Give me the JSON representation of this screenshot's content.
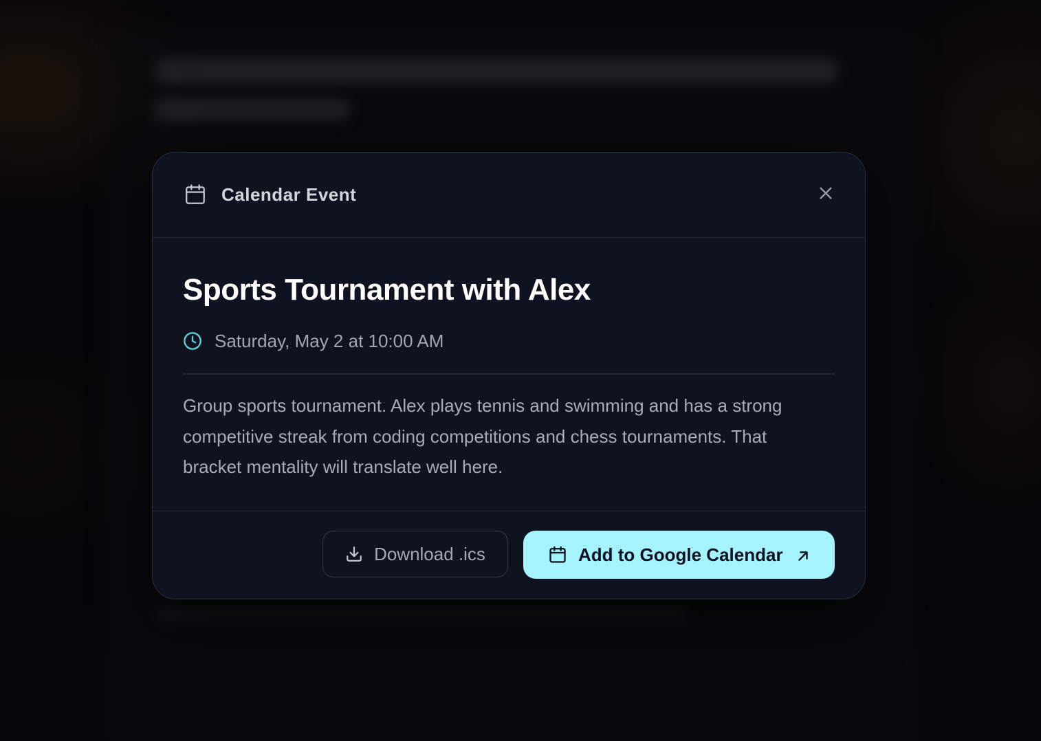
{
  "modal": {
    "header_title": "Calendar Event",
    "event_title": "Sports Tournament with Alex",
    "event_time": "Saturday, May 2 at 10:00 AM",
    "description": "Group sports tournament. Alex plays tennis and swimming and has a strong competitive streak from coding competitions and chess tournaments. That bracket mentality will translate well here.",
    "download_label": "Download .ics",
    "google_label": "Add to Google Calendar"
  },
  "icons": {
    "header": "calendar-icon",
    "close": "close-icon",
    "time": "clock-icon",
    "download": "download-icon",
    "google": "calendar-icon",
    "external": "arrow-up-right-icon"
  },
  "colors": {
    "accent": "#a5f3fc",
    "clock": "#5fd0d8",
    "modal_bg": "#0f1320"
  }
}
